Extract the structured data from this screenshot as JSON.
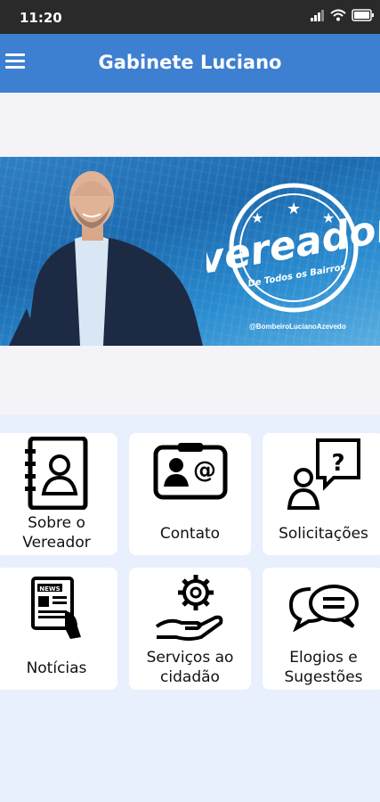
{
  "status": {
    "time": "11:20"
  },
  "appbar": {
    "title": "Gabinete Luciano"
  },
  "banner": {
    "badge_main": "vereador",
    "badge_sub": "De Todos os Bairros",
    "handle": "@BombeiroLucianoAzevedo"
  },
  "menu": [
    {
      "line1": "Sobre o",
      "line2": "Vereador",
      "icon": "address-book-icon"
    },
    {
      "line1": "Contato",
      "line2": "",
      "icon": "contact-card-icon"
    },
    {
      "line1": "Solicitações",
      "line2": "",
      "icon": "question-person-icon"
    },
    {
      "line1": "Notícias",
      "line2": "",
      "icon": "newspaper-icon"
    },
    {
      "line1": "Serviços ao",
      "line2": "cidadão",
      "icon": "gear-hand-icon"
    },
    {
      "line1": "Elogios e",
      "line2": "Sugestões",
      "icon": "chat-bubbles-icon"
    }
  ],
  "colors": {
    "appbar": "#3d7fd0",
    "statusbar": "#2a2a2a",
    "background": "#e8effd"
  }
}
